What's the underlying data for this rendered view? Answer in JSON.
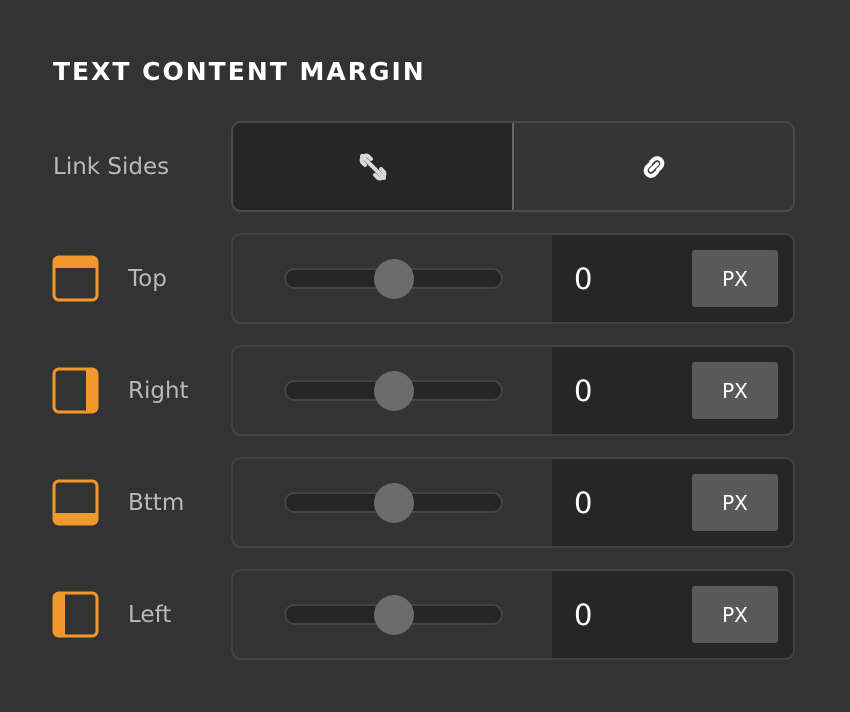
{
  "section": {
    "title": "TEXT CONTENT MARGIN"
  },
  "link_sides": {
    "label": "Link Sides",
    "options": [
      {
        "icon": "unlink-icon",
        "selected": false
      },
      {
        "icon": "link-icon",
        "selected": true
      }
    ]
  },
  "colors": {
    "accent": "#f0982b",
    "panel_bg": "#333333",
    "field_bg": "#262626",
    "thumb": "#6b6b6b",
    "unit_button": "#595959"
  },
  "rows": [
    {
      "label": "Top",
      "icon": "margin-top-icon",
      "value": "0",
      "unit": "PX",
      "slider_fraction": 0.5
    },
    {
      "label": "Right",
      "icon": "margin-right-icon",
      "value": "0",
      "unit": "PX",
      "slider_fraction": 0.5
    },
    {
      "label": "Bttm",
      "icon": "margin-bottom-icon",
      "value": "0",
      "unit": "PX",
      "slider_fraction": 0.5
    },
    {
      "label": "Left",
      "icon": "margin-left-icon",
      "value": "0",
      "unit": "PX",
      "slider_fraction": 0.5
    }
  ]
}
